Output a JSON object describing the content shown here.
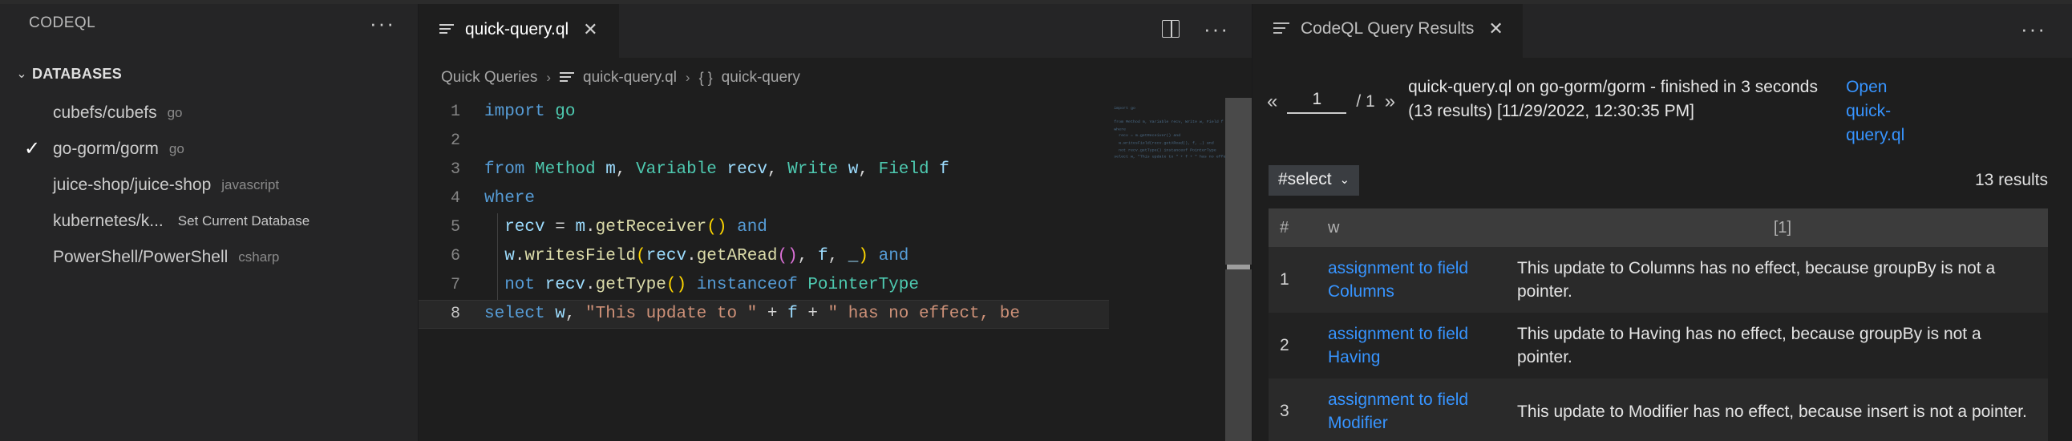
{
  "sidebar": {
    "title": "CODEQL",
    "more_label": "···",
    "section": {
      "label": "DATABASES",
      "chevron": "⌄"
    },
    "databases": [
      {
        "name": "cubefs/cubefs",
        "language": "go",
        "selected": false,
        "hint": ""
      },
      {
        "name": "go-gorm/gorm",
        "language": "go",
        "selected": true,
        "hint": ""
      },
      {
        "name": "juice-shop/juice-shop",
        "language": "javascript",
        "selected": false,
        "hint": ""
      },
      {
        "name": "kubernetes/k...",
        "language": "",
        "selected": false,
        "hint": "Set Current Database"
      },
      {
        "name": "PowerShell/PowerShell",
        "language": "csharp",
        "selected": false,
        "hint": ""
      }
    ],
    "check_glyph": "✓"
  },
  "editor": {
    "tab": {
      "label": "quick-query.ql",
      "close_glyph": "✕"
    },
    "actions": {
      "split_editor_title": "Split Editor",
      "more_label": "···"
    },
    "breadcrumb": [
      {
        "text": "Quick Queries",
        "icon": ""
      },
      {
        "text": "quick-query.ql",
        "icon": "file-lines-icon"
      },
      {
        "text": "quick-query",
        "icon": "braces-icon"
      }
    ],
    "breadcrumb_separator": "›",
    "code": {
      "lines": [
        {
          "n": "1",
          "tokens": [
            {
              "t": "import ",
              "c": "t-key"
            },
            {
              "t": "go",
              "c": "t-type"
            }
          ]
        },
        {
          "n": "2",
          "tokens": []
        },
        {
          "n": "3",
          "tokens": [
            {
              "t": "from ",
              "c": "t-key"
            },
            {
              "t": "Method",
              "c": "t-type"
            },
            {
              "t": " m",
              "c": "t-var"
            },
            {
              "t": ", ",
              "c": "t-punc"
            },
            {
              "t": "Variable",
              "c": "t-type"
            },
            {
              "t": " recv",
              "c": "t-var"
            },
            {
              "t": ", ",
              "c": "t-punc"
            },
            {
              "t": "Write",
              "c": "t-type"
            },
            {
              "t": " w",
              "c": "t-var"
            },
            {
              "t": ", ",
              "c": "t-punc"
            },
            {
              "t": "Field",
              "c": "t-type"
            },
            {
              "t": " f",
              "c": "t-var"
            }
          ]
        },
        {
          "n": "4",
          "tokens": [
            {
              "t": "where",
              "c": "t-key"
            }
          ]
        },
        {
          "n": "5",
          "tokens": [
            {
              "t": "  recv",
              "c": "t-var"
            },
            {
              "t": " = ",
              "c": "t-punc"
            },
            {
              "t": "m",
              "c": "t-var"
            },
            {
              "t": ".",
              "c": "t-punc"
            },
            {
              "t": "getReceiver",
              "c": "t-fn"
            },
            {
              "t": "()",
              "c": "t-yel"
            },
            {
              "t": " and",
              "c": "t-key"
            }
          ]
        },
        {
          "n": "6",
          "tokens": [
            {
              "t": "  w",
              "c": "t-var"
            },
            {
              "t": ".",
              "c": "t-punc"
            },
            {
              "t": "writesField",
              "c": "t-fn"
            },
            {
              "t": "(",
              "c": "t-yel"
            },
            {
              "t": "recv",
              "c": "t-var"
            },
            {
              "t": ".",
              "c": "t-punc"
            },
            {
              "t": "getARead",
              "c": "t-fn"
            },
            {
              "t": "()",
              "c": "t-mag"
            },
            {
              "t": ", ",
              "c": "t-punc"
            },
            {
              "t": "f",
              "c": "t-var"
            },
            {
              "t": ", ",
              "c": "t-punc"
            },
            {
              "t": "_",
              "c": "t-var"
            },
            {
              "t": ")",
              "c": "t-yel"
            },
            {
              "t": " and",
              "c": "t-key"
            }
          ]
        },
        {
          "n": "7",
          "tokens": [
            {
              "t": "  not ",
              "c": "t-key"
            },
            {
              "t": "recv",
              "c": "t-var"
            },
            {
              "t": ".",
              "c": "t-punc"
            },
            {
              "t": "getType",
              "c": "t-fn"
            },
            {
              "t": "()",
              "c": "t-yel"
            },
            {
              "t": " instanceof ",
              "c": "t-key"
            },
            {
              "t": "PointerType",
              "c": "t-type"
            }
          ]
        },
        {
          "n": "8",
          "tokens": [
            {
              "t": "select ",
              "c": "t-key"
            },
            {
              "t": "w",
              "c": "t-var"
            },
            {
              "t": ", ",
              "c": "t-punc"
            },
            {
              "t": "\"This update to \"",
              "c": "t-str"
            },
            {
              "t": " + ",
              "c": "t-punc"
            },
            {
              "t": "f",
              "c": "t-var"
            },
            {
              "t": " + ",
              "c": "t-punc"
            },
            {
              "t": "\" has no effect, be",
              "c": "t-str"
            }
          ],
          "active": true
        }
      ],
      "active_line": "8"
    },
    "minimap_text": "import go\n\nfrom Method m, Variable recv, Write w, Field f\nwhere\n  recv = m.getReceiver() and\n  w.writesField(recv.getARead(), f, _) and\n  not recv.getType() instanceof PointerType\nselect w, \"This update to \" + f + \" has no effect, because\""
  },
  "results": {
    "tab": {
      "label": "CodeQL Query Results",
      "close_glyph": "✕"
    },
    "more_label": "···",
    "pager": {
      "first_glyph": "«",
      "last_glyph": "»",
      "current_page": "1",
      "total_pages": "/ 1"
    },
    "run_status": "quick-query.ql on go-gorm/gorm - finished in 3 seconds (13 results) [11/29/2022, 12:30:35 PM]",
    "open_link": "Open quick-query.ql",
    "select_chip": {
      "label": "#select",
      "chevron": "⌄"
    },
    "result_count": "13 results",
    "table": {
      "headers": [
        "#",
        "w",
        "[1]"
      ],
      "rows": [
        {
          "index": "1",
          "w": "assignment to field Columns",
          "message": "This update to Columns has no effect, because groupBy is not a pointer."
        },
        {
          "index": "2",
          "w": "assignment to field Having",
          "message": "This update to Having has no effect, because groupBy is not a pointer."
        },
        {
          "index": "3",
          "w": "assignment to field Modifier",
          "message": "This update to Modifier has no effect, because insert is not a pointer."
        }
      ]
    }
  },
  "colors": {
    "accent_link": "#3794ff",
    "sidebar_bg": "#252526",
    "editor_bg": "#1e1e1e",
    "table_header_bg": "#3c3c3c"
  }
}
